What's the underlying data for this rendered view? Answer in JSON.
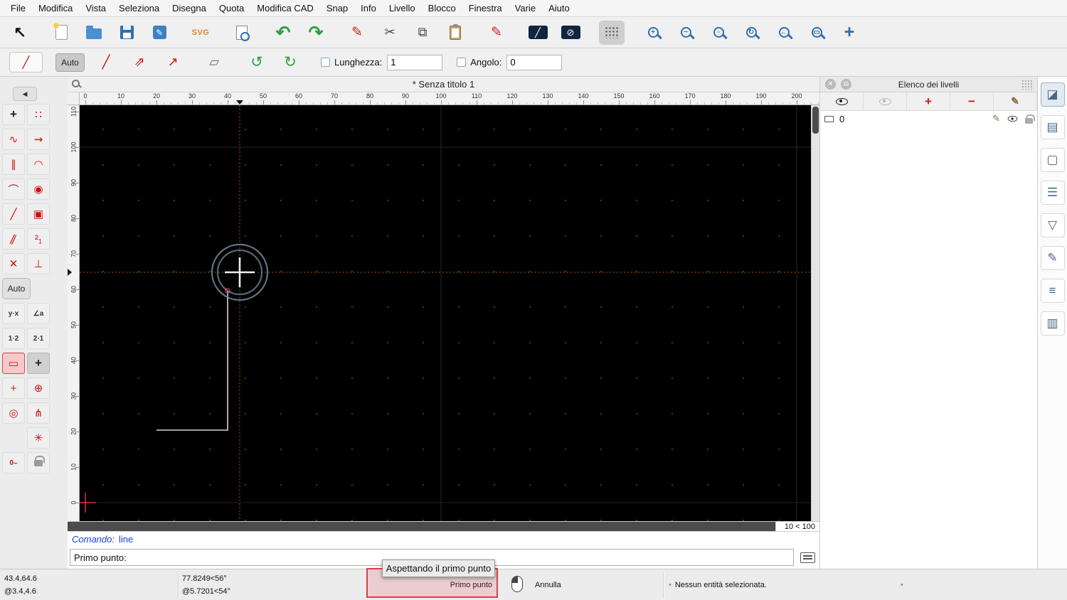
{
  "menu": {
    "items": [
      "File",
      "Modifica",
      "Vista",
      "Seleziona",
      "Disegna",
      "Quota",
      "Modifica CAD",
      "Snap",
      "Info",
      "Livello",
      "Blocco",
      "Finestra",
      "Varie",
      "Aiuto"
    ]
  },
  "toolbar": {
    "buttons": [
      {
        "name": "select-cursor-button",
        "glyph": "↖",
        "cls": "cursor"
      },
      {
        "name": "new-file-button",
        "glyph": "",
        "cls": "pagei gap"
      },
      {
        "name": "open-file-button",
        "glyph": "",
        "cls": "folderi"
      },
      {
        "name": "save-button",
        "glyph": "",
        "cls": "floppyi"
      },
      {
        "name": "edit-drawing-button",
        "glyph": "✎",
        "cls": "editi"
      },
      {
        "name": "svg-library-button",
        "glyph": "SVG",
        "cls": "svgi gap"
      },
      {
        "name": "print-preview-button",
        "glyph": "",
        "cls": "previewi gap"
      },
      {
        "name": "undo-button",
        "glyph": "↶",
        "cls": "green gap"
      },
      {
        "name": "redo-button",
        "glyph": "↷",
        "cls": "green"
      },
      {
        "name": "delete-button",
        "glyph": "✎",
        "cls": "redpen gap"
      },
      {
        "name": "cut-button",
        "glyph": "✂",
        "cls": "plain"
      },
      {
        "name": "copy-button",
        "glyph": "⧉",
        "cls": "plain"
      },
      {
        "name": "paste-button",
        "glyph": "",
        "cls": "clipi"
      },
      {
        "name": "pen-edit-button",
        "glyph": "✎",
        "cls": "redpen gap"
      },
      {
        "name": "line-selection-button",
        "glyph": "╱",
        "cls": "boxdark gap"
      },
      {
        "name": "ellipse-selection-button",
        "glyph": "⊘",
        "cls": "boxdark"
      },
      {
        "name": "grid-toggle-button",
        "glyph": "",
        "cls": "gridsel sel gap"
      },
      {
        "name": "zoom-in-button",
        "glyph": "+",
        "cls": "magi gap"
      },
      {
        "name": "zoom-out-button",
        "glyph": "−",
        "cls": "magi"
      },
      {
        "name": "zoom-auto-button",
        "glyph": "▫",
        "cls": "magi"
      },
      {
        "name": "zoom-redraw-button",
        "glyph": "↻",
        "cls": "magi"
      },
      {
        "name": "zoom-previous-button",
        "glyph": "←",
        "cls": "magi"
      },
      {
        "name": "zoom-window-button",
        "glyph": "▭",
        "cls": "magi"
      },
      {
        "name": "pan-button",
        "glyph": "+",
        "cls": "pani"
      }
    ]
  },
  "tool_options": {
    "current_tool_glyph": "╱",
    "auto_label": "Auto",
    "line_modes": [
      {
        "name": "line-mode-two-points",
        "glyph": "╱",
        "cls": ""
      },
      {
        "name": "line-mode-segments",
        "glyph": "⇗",
        "cls": ""
      },
      {
        "name": "line-mode-angle",
        "glyph": "↗",
        "cls": ""
      }
    ],
    "polyline_glyph": "▱",
    "undo_segment_glyph": "↺",
    "redo_segment_glyph": "↻",
    "length": {
      "label": "Lunghezza:",
      "value": "1"
    },
    "angle": {
      "label": "Angolo:",
      "value": "0"
    }
  },
  "palette": {
    "collapse_glyph": "◀",
    "buttons": [
      {
        "name": "tool-point",
        "glyph": "+",
        "cls": "dark"
      },
      {
        "name": "tool-point-grid",
        "glyph": "∷",
        "cls": "red"
      },
      {
        "name": "tool-spline-points",
        "glyph": "∿",
        "cls": "red"
      },
      {
        "name": "tool-polyline-segments",
        "glyph": "⇝",
        "cls": "red"
      },
      {
        "name": "tool-parallel-lines",
        "glyph": "∥",
        "cls": "red"
      },
      {
        "name": "tool-arc-endpoint",
        "glyph": "◠",
        "cls": "red"
      },
      {
        "name": "tool-tangent-arc",
        "glyph": "⌒",
        "cls": "red"
      },
      {
        "name": "tool-circle-center",
        "glyph": "◉",
        "cls": "red"
      },
      {
        "name": "tool-line-endpoint",
        "glyph": "╱",
        "cls": "red"
      },
      {
        "name": "tool-rect-corner",
        "glyph": "▣",
        "cls": "red"
      },
      {
        "name": "tool-hatch-lines",
        "glyph": "∥",
        "cls": "red slant"
      },
      {
        "name": "tool-sequence-2-1",
        "glyph": "²₁",
        "cls": "red"
      },
      {
        "name": "tool-line-cross",
        "glyph": "✕",
        "cls": "red"
      },
      {
        "name": "tool-perpendicular",
        "glyph": "⊥",
        "cls": "red"
      },
      {
        "name": "auto-snap-button",
        "glyph": "Auto",
        "cls": "wide"
      },
      {
        "name": "coord-cartesian",
        "glyph": "y·x",
        "cls": "tiny"
      },
      {
        "name": "coord-angle",
        "glyph": "∠a",
        "cls": "tiny"
      },
      {
        "name": "coord-relative-1-2",
        "glyph": "1·2",
        "cls": "tiny"
      },
      {
        "name": "coord-relative-2-1",
        "glyph": "2·1",
        "cls": "tiny"
      },
      {
        "name": "snap-selected-entity",
        "glyph": "▭",
        "cls": "selred"
      },
      {
        "name": "snap-free",
        "glyph": "+",
        "cls": "pressed dark"
      },
      {
        "name": "snap-grid-points",
        "glyph": "+",
        "cls": "red"
      },
      {
        "name": "snap-center",
        "glyph": "⊕",
        "cls": "red"
      },
      {
        "name": "snap-endpoint",
        "glyph": "◎",
        "cls": "red"
      },
      {
        "name": "snap-angle-rays",
        "glyph": "⋔",
        "cls": "red"
      },
      {
        "name": "palette-blank-1",
        "glyph": "",
        "cls": "blank"
      },
      {
        "name": "snap-auto-intersection",
        "glyph": "✳",
        "cls": "red"
      },
      {
        "name": "restrict-lock-zero",
        "glyph": "0–",
        "cls": "tiny red"
      },
      {
        "name": "snap-lock",
        "glyph": "",
        "cls": "lockic"
      },
      {
        "name": "palette-blank-2",
        "glyph": "",
        "cls": "blank"
      }
    ]
  },
  "document": {
    "title": "* Senza titolo 1"
  },
  "rulers": {
    "horizontal": [
      "0",
      "10",
      "20",
      "30",
      "40",
      "50",
      "60",
      "70",
      "80",
      "90",
      "100",
      "110",
      "120",
      "130",
      "140",
      "150",
      "160",
      "170",
      "180",
      "190",
      "200"
    ],
    "vertical": [
      "110",
      "100",
      "90",
      "80",
      "70",
      "60",
      "50",
      "40",
      "30",
      "20",
      "10",
      "0"
    ]
  },
  "canvas": {
    "grid_status": "10 < 100"
  },
  "layers_panel": {
    "title": "Elenco dei livelli",
    "close_glyph": "✕",
    "detach_glyph": "⧉",
    "toolbar": [
      {
        "name": "show-all-layers-button",
        "glyph": "",
        "cls": "eyed"
      },
      {
        "name": "hide-all-layers-button",
        "glyph": "",
        "cls": "eyel"
      },
      {
        "name": "add-layer-button",
        "glyph": "+",
        "cls": "plusred"
      },
      {
        "name": "remove-layer-button",
        "glyph": "−",
        "cls": "minusred"
      },
      {
        "name": "edit-layer-button",
        "glyph": "✎",
        "cls": "pencil"
      }
    ],
    "layers": [
      {
        "name": "0"
      }
    ]
  },
  "right_strip": {
    "buttons": [
      {
        "name": "property-editor-panel-button",
        "glyph": "◪",
        "cls": "sel"
      },
      {
        "name": "layer-list-panel-button",
        "glyph": "▤",
        "cls": ""
      },
      {
        "name": "block-list-panel-button",
        "glyph": "▢",
        "cls": ""
      },
      {
        "name": "view-list-panel-button",
        "glyph": "☰",
        "cls": ""
      },
      {
        "name": "selection-filter-panel-button",
        "glyph": "▽",
        "cls": ""
      },
      {
        "name": "library-browser-panel-button",
        "glyph": "✎",
        "cls": ""
      },
      {
        "name": "command-history-panel-button",
        "glyph": "≡",
        "cls": ""
      },
      {
        "name": "clipboard-panel-button",
        "glyph": "▥",
        "cls": ""
      }
    ]
  },
  "command": {
    "prompt_label": "Comando:",
    "command": "line",
    "input_label": "Primo punto:"
  },
  "tooltip": {
    "text": "Aspettando il primo punto"
  },
  "statusbar": {
    "abs_coord": "43.4,64.6",
    "rel_coord": "@3.4,4.6",
    "polar_abs": "77.8249<56°",
    "polar_rel": "@5.7201<54°",
    "left_click_action": "Primo punto",
    "right_click_action": "Annulla",
    "selection_bullet": "•",
    "selection_status": "Nessun entità selezionata.",
    "right_bullet": "•"
  }
}
